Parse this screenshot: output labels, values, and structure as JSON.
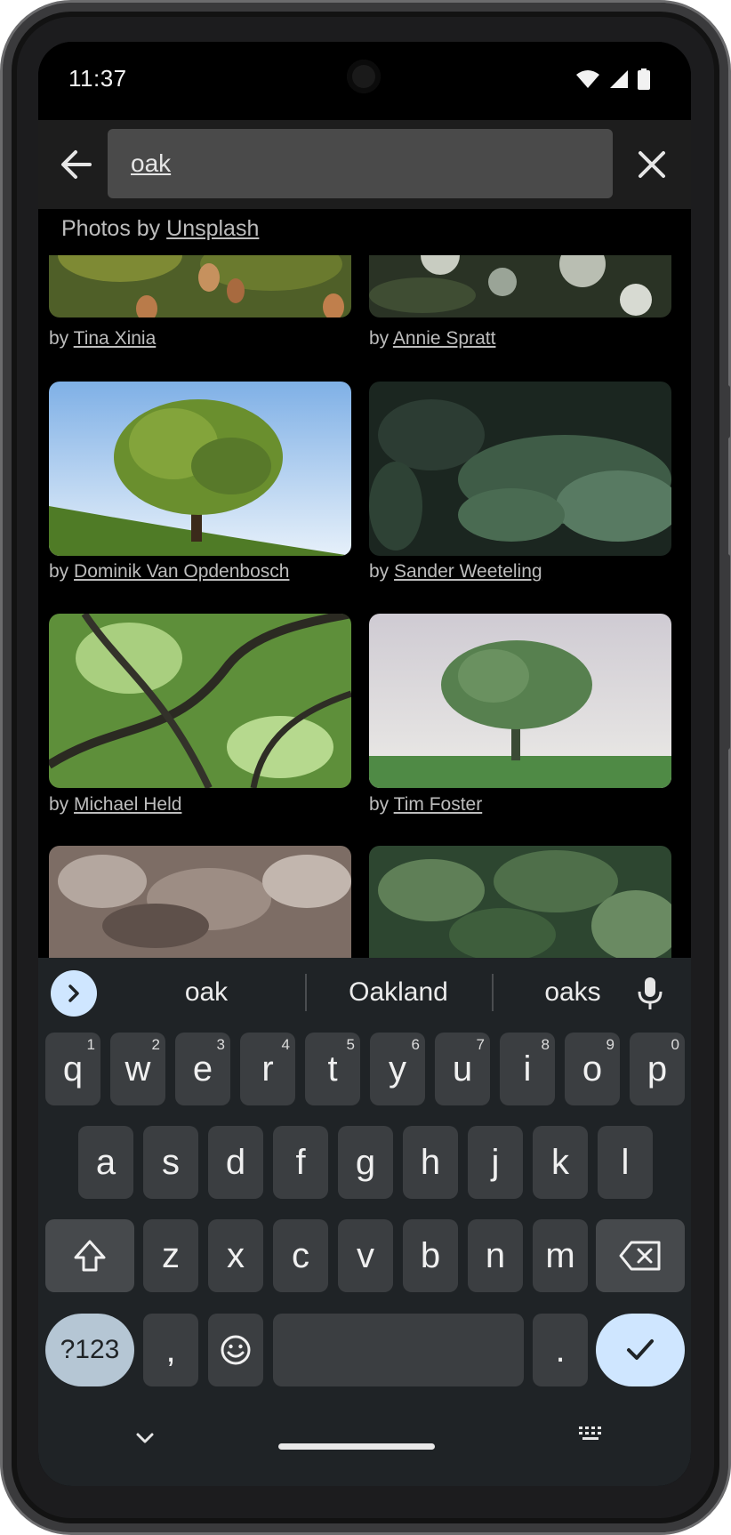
{
  "status_bar": {
    "time": "11:37"
  },
  "search": {
    "value": "oak"
  },
  "credits": {
    "prefix": "Photos by",
    "source": "Unsplash"
  },
  "photos": [
    {
      "by": "by",
      "author": "Tina Xinia",
      "palette": [
        "#5a6b2f",
        "#8a8f3e",
        "#b07a48"
      ]
    },
    {
      "by": "by",
      "author": "Annie Spratt",
      "palette": [
        "#2b3426",
        "#4a5a3a",
        "#c9cdc2"
      ]
    },
    {
      "by": "by",
      "author": "Dominik Van Opdenbosch",
      "palette": [
        "#a9c8ea",
        "#5f8a2c",
        "#6d8d3a"
      ]
    },
    {
      "by": "by",
      "author": "Sander Weeteling",
      "palette": [
        "#1e2a22",
        "#3f5a45",
        "#7a9583"
      ]
    },
    {
      "by": "by",
      "author": "Michael Held",
      "palette": [
        "#5b8c3a",
        "#2e3b24",
        "#cfe3b8"
      ]
    },
    {
      "by": "by",
      "author": "Tim Foster",
      "palette": [
        "#d9d7dc",
        "#4f7a4a",
        "#5d8c3e"
      ]
    },
    {
      "by": "",
      "author": "",
      "palette": [
        "#8f7e74",
        "#6a5c55",
        "#b7aba3"
      ]
    },
    {
      "by": "",
      "author": "",
      "palette": [
        "#3e5e3c",
        "#5f7f57",
        "#2d4630"
      ]
    }
  ],
  "keyboard": {
    "suggestions": [
      "oak",
      "Oakland",
      "oaks"
    ],
    "row1": [
      {
        "key": "q",
        "hint": "1"
      },
      {
        "key": "w",
        "hint": "2"
      },
      {
        "key": "e",
        "hint": "3"
      },
      {
        "key": "r",
        "hint": "4"
      },
      {
        "key": "t",
        "hint": "5"
      },
      {
        "key": "y",
        "hint": "6"
      },
      {
        "key": "u",
        "hint": "7"
      },
      {
        "key": "i",
        "hint": "8"
      },
      {
        "key": "o",
        "hint": "9"
      },
      {
        "key": "p",
        "hint": "0"
      }
    ],
    "row2": [
      "a",
      "s",
      "d",
      "f",
      "g",
      "h",
      "j",
      "k",
      "l"
    ],
    "row3": [
      "z",
      "x",
      "c",
      "v",
      "b",
      "n",
      "m"
    ],
    "symbols_label": "?123",
    "comma": ",",
    "period": "."
  },
  "colors": {
    "accent": "#cfe6ff",
    "screen": "#000000",
    "keyboard": "#1f2326"
  }
}
